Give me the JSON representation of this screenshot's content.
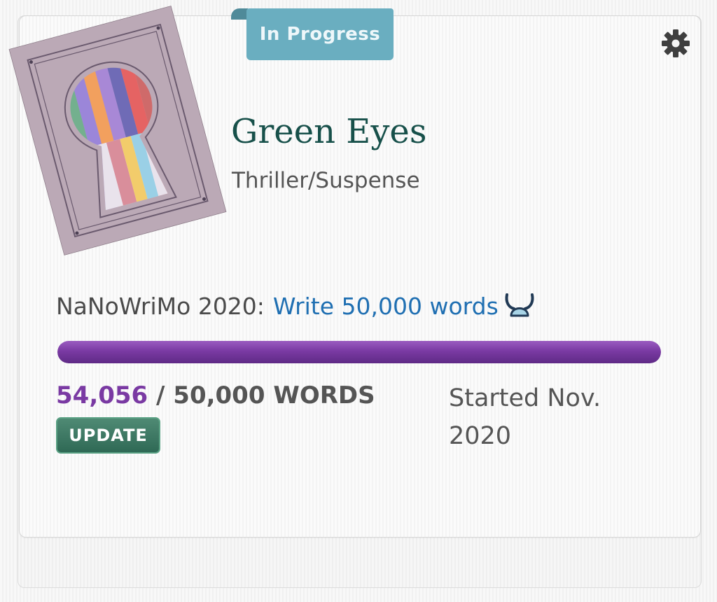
{
  "project": {
    "status": "In Progress",
    "title": "Green Eyes",
    "genre": "Thriller/Suspense",
    "goal_prefix": "NaNoWriMo 2020:",
    "goal_text": "Write 50,000 words",
    "progress_fraction": 1.0,
    "word_count_current": "54,056",
    "word_count_separator": " / ",
    "word_count_goal": "50,000 WORDS",
    "update_label": "UPDATE",
    "started_label": "Started Nov. 2020"
  },
  "icons": {
    "settings": "gear-icon",
    "goal_badge": "viking-helmet-icon",
    "cover": "keyhole-book-cover"
  },
  "colors": {
    "title": "#17504a",
    "status_tab": "#6aaec0",
    "goal_link": "#1f6fb2",
    "progress": "#7a3aa3",
    "update_button": "#2f6955"
  }
}
